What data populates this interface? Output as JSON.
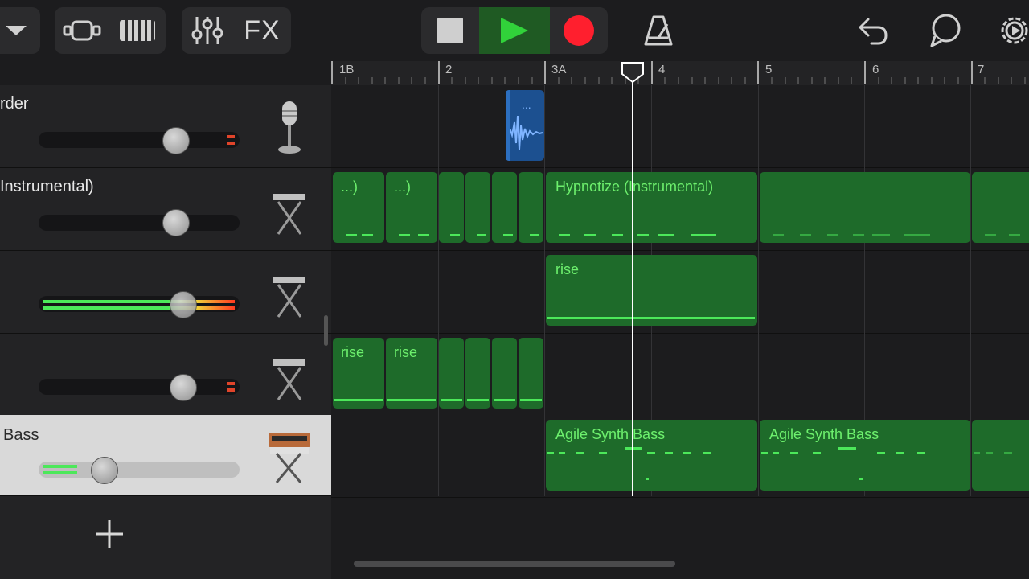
{
  "toolbar": {
    "fx_label": "FX",
    "icons": [
      "chevron-down-icon",
      "view-toggle-icon",
      "keyboard-icon",
      "mixer-icon",
      "stop-icon",
      "play-icon",
      "record-icon",
      "metronome-icon",
      "undo-icon",
      "loop-icon",
      "settings-icon"
    ],
    "play_color": "#31d23a",
    "record_color": "#ff1f2e"
  },
  "ruler": {
    "markers": [
      "1B",
      "2",
      "3A",
      "4",
      "5",
      "6",
      "7"
    ]
  },
  "tracks": [
    {
      "name": "rder",
      "icon": "microphone-icon"
    },
    {
      "name": "Instrumental)",
      "icon": "keyboard-stand-icon"
    },
    {
      "name": "",
      "icon": "keyboard-stand-icon"
    },
    {
      "name": "",
      "icon": "keyboard-stand-icon"
    },
    {
      "name": "Bass",
      "icon": "synth-icon"
    }
  ],
  "regions": {
    "audio_label": "...",
    "t2_short": [
      "...)",
      "...)"
    ],
    "t2_main": "Hypnotize (Instrumental)",
    "t3_main": "rise",
    "t4_short": [
      "rise",
      "rise"
    ],
    "t5_a": "Agile Synth Bass",
    "t5_b": "Agile Synth Bass"
  },
  "add_track_icon": "plus-icon",
  "colors": {
    "region_green": "#1e6b2a",
    "region_text": "#6df06d",
    "audio_blue": "#1c5090",
    "selected_header": "#d9d9d9"
  }
}
